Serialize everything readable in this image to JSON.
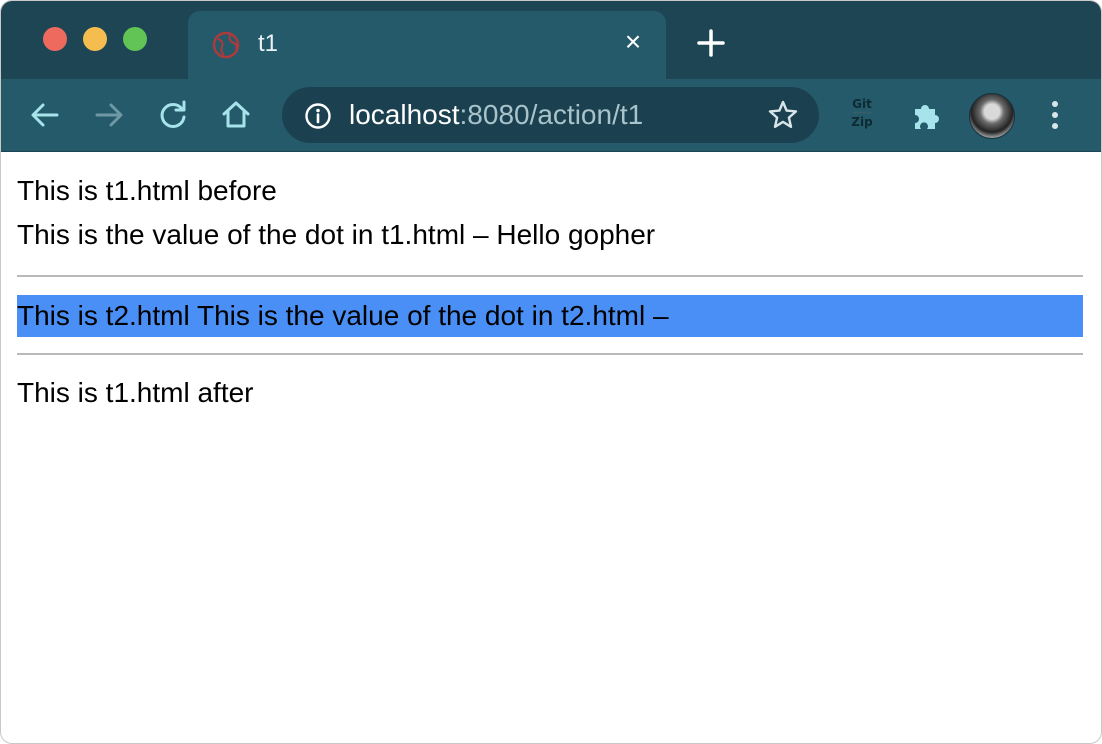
{
  "tab": {
    "title": "t1",
    "close_glyph": "×"
  },
  "newtab": {
    "label": "+"
  },
  "toolbar": {
    "url_host": "localhost",
    "url_path": ":8080/action/t1",
    "extension_gitzip": {
      "line1": "Git",
      "line2": "Zip"
    }
  },
  "page": {
    "line1": "This is t1.html before",
    "line2": "This is the value of the dot in t1.html – Hello gopher",
    "highlighted": "This is t2.html This is the value of the dot in t2.html –",
    "after": "This is t1.html after"
  },
  "colors": {
    "tabstrip": "#1d4554",
    "toolbar": "#255a6b",
    "omnibox": "#1b4150",
    "selection": "#4a8ff5"
  }
}
